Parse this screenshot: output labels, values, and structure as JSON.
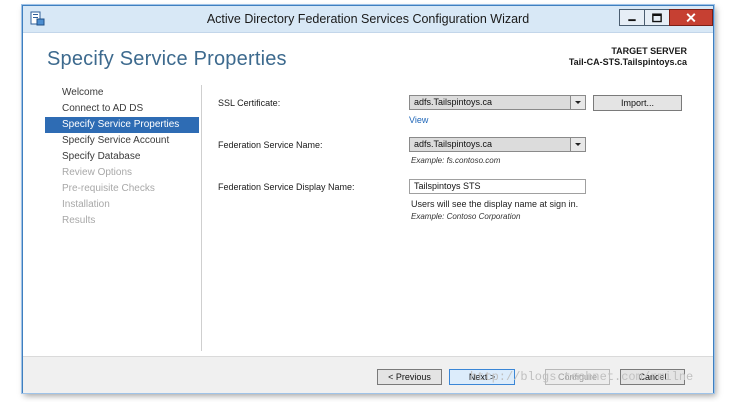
{
  "window": {
    "title": "Active Directory Federation Services Configuration Wizard",
    "icon": "adfs-app-icon",
    "controls": [
      "minimize-icon",
      "maximize-icon",
      "close-icon"
    ]
  },
  "header": {
    "title": "Specify Service Properties",
    "target_label": "TARGET SERVER",
    "target_name": "Tail-CA-STS.Tailspintoys.ca"
  },
  "nav": {
    "items": [
      {
        "label": "Welcome",
        "state": "normal"
      },
      {
        "label": "Connect to AD DS",
        "state": "normal"
      },
      {
        "label": "Specify Service Properties",
        "state": "active"
      },
      {
        "label": "Specify Service Account",
        "state": "normal"
      },
      {
        "label": "Specify Database",
        "state": "normal"
      },
      {
        "label": "Review Options",
        "state": "disabled"
      },
      {
        "label": "Pre-requisite Checks",
        "state": "disabled"
      },
      {
        "label": "Installation",
        "state": "disabled"
      },
      {
        "label": "Results",
        "state": "disabled"
      }
    ]
  },
  "form": {
    "ssl": {
      "label": "SSL Certificate:",
      "value": "adfs.Tailspintoys.ca",
      "import_label": "Import...",
      "view_label": "View"
    },
    "fsname": {
      "label": "Federation Service Name:",
      "value": "adfs.Tailspintoys.ca",
      "example": "Example: fs.contoso.com"
    },
    "display": {
      "label": "Federation Service Display Name:",
      "value": "Tailspintoys STS",
      "note": "Users will see the display name at sign in.",
      "example": "Example: Contoso Corporation"
    }
  },
  "footer": {
    "previous": "< Previous",
    "next": "Next >",
    "configure": "Configure",
    "cancel": "Cancel"
  },
  "watermark": "http://blogs.technet.com/rmilne",
  "colors": {
    "accent": "#2e6cb4",
    "title": "#3d6a8e",
    "link": "#1f66b8",
    "close": "#c64032"
  }
}
